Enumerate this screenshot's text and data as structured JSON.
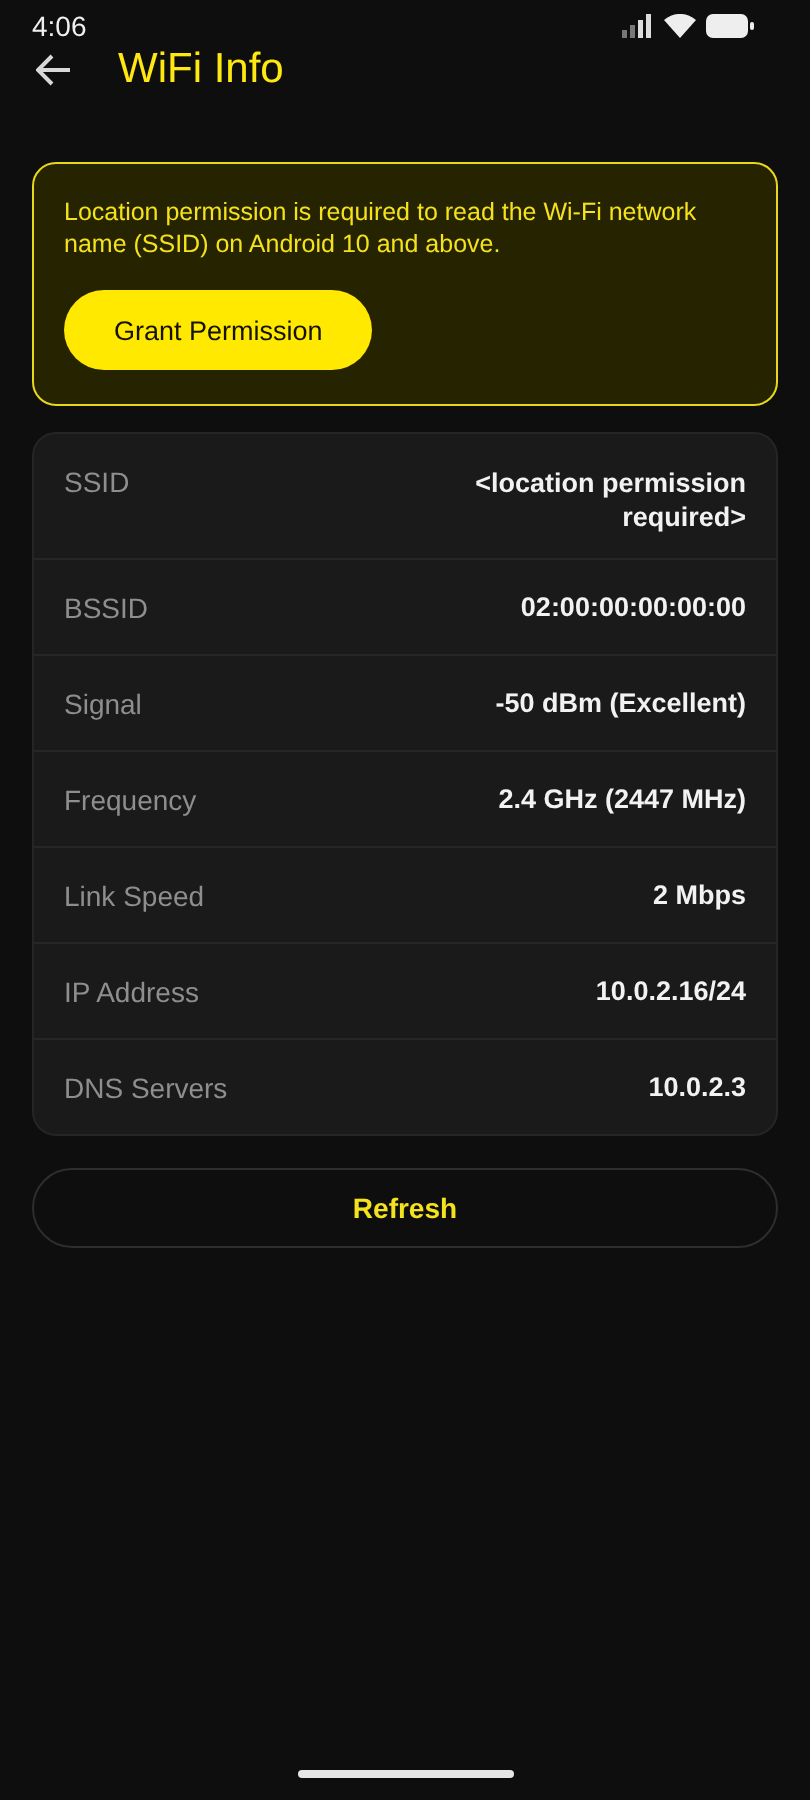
{
  "status_bar": {
    "time": "4:06"
  },
  "app_bar": {
    "title": "WiFi Info"
  },
  "permission_banner": {
    "message": "Location permission is required to read the Wi-Fi network name (SSID) on Android 10 and above.",
    "button": "Grant Permission"
  },
  "info_rows": [
    {
      "label": "SSID",
      "value": "<location permission required>"
    },
    {
      "label": "BSSID",
      "value": "02:00:00:00:00:00"
    },
    {
      "label": "Signal",
      "value": "-50 dBm (Excellent)"
    },
    {
      "label": "Frequency",
      "value": "2.4 GHz (2447 MHz)"
    },
    {
      "label": "Link Speed",
      "value": "2 Mbps"
    },
    {
      "label": "IP Address",
      "value": "10.0.2.16/24"
    },
    {
      "label": "DNS Servers",
      "value": "10.0.2.3"
    }
  ],
  "refresh_button": "Refresh"
}
